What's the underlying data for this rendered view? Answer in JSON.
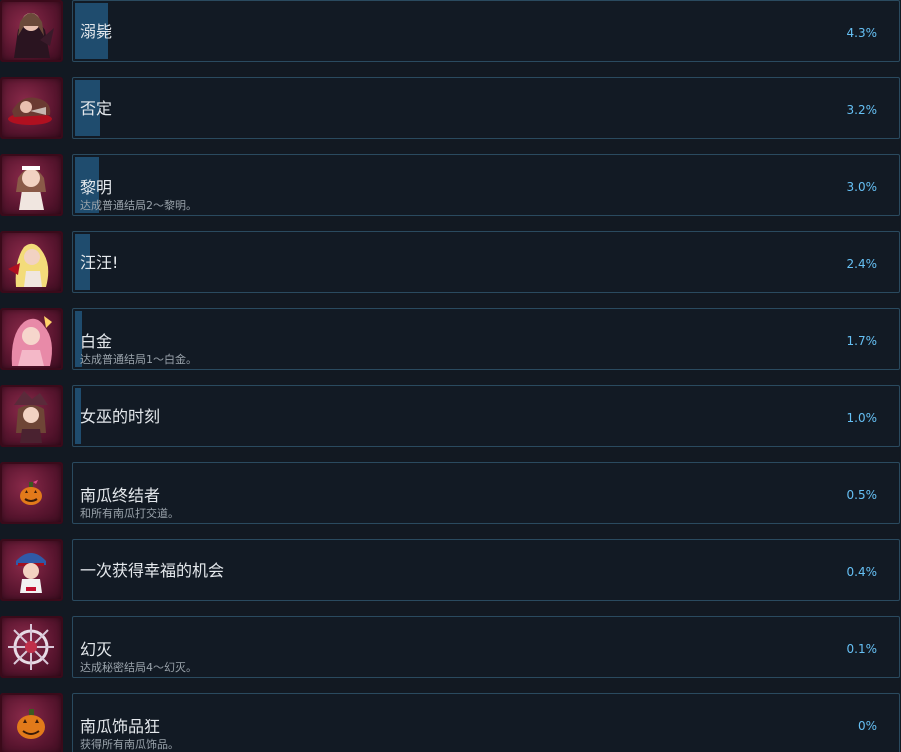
{
  "achievements": [
    {
      "title": "溺毙",
      "description": "",
      "percent_label": "4.3%",
      "percent": 4.3,
      "icon": "dark-witch-icon"
    },
    {
      "title": "否定",
      "description": "",
      "percent_label": "3.2%",
      "percent": 3.2,
      "icon": "fallen-girl-icon"
    },
    {
      "title": "黎明",
      "description": "达成普通结局2～黎明。",
      "percent_label": "3.0%",
      "percent": 3.0,
      "icon": "white-dress-girl-icon"
    },
    {
      "title": "汪汪!",
      "description": "",
      "percent_label": "2.4%",
      "percent": 2.4,
      "icon": "blonde-girl-icon"
    },
    {
      "title": "白金",
      "description": "达成普通结局1～白金。",
      "percent_label": "1.7%",
      "percent": 1.7,
      "icon": "pink-hair-girl-icon"
    },
    {
      "title": "女巫的时刻",
      "description": "",
      "percent_label": "1.0%",
      "percent": 1.0,
      "icon": "witch-hat-girl-icon"
    },
    {
      "title": "南瓜终结者",
      "description": "和所有南瓜打交道。",
      "percent_label": "0.5%",
      "percent": 0.5,
      "icon": "small-pumpkin-icon"
    },
    {
      "title": "一次获得幸福的机会",
      "description": "",
      "percent_label": "0.4%",
      "percent": 0.4,
      "icon": "blue-hat-girl-icon"
    },
    {
      "title": "幻灭",
      "description": "达成秘密结局4～幻灭。",
      "percent_label": "0.1%",
      "percent": 0.1,
      "icon": "shattered-emblem-icon"
    },
    {
      "title": "南瓜饰品狂",
      "description": "获得所有南瓜饰品。",
      "percent_label": "0%",
      "percent": 0,
      "icon": "large-pumpkin-icon"
    }
  ],
  "colors": {
    "background": "#121922",
    "card_border": "#2a4a5f",
    "progress_fill": "#1f4c6e",
    "percent_text": "#66c0f4",
    "title_text": "#e4e8ec",
    "desc_text": "#9aa3ab",
    "icon_frame": "#5b1630"
  }
}
